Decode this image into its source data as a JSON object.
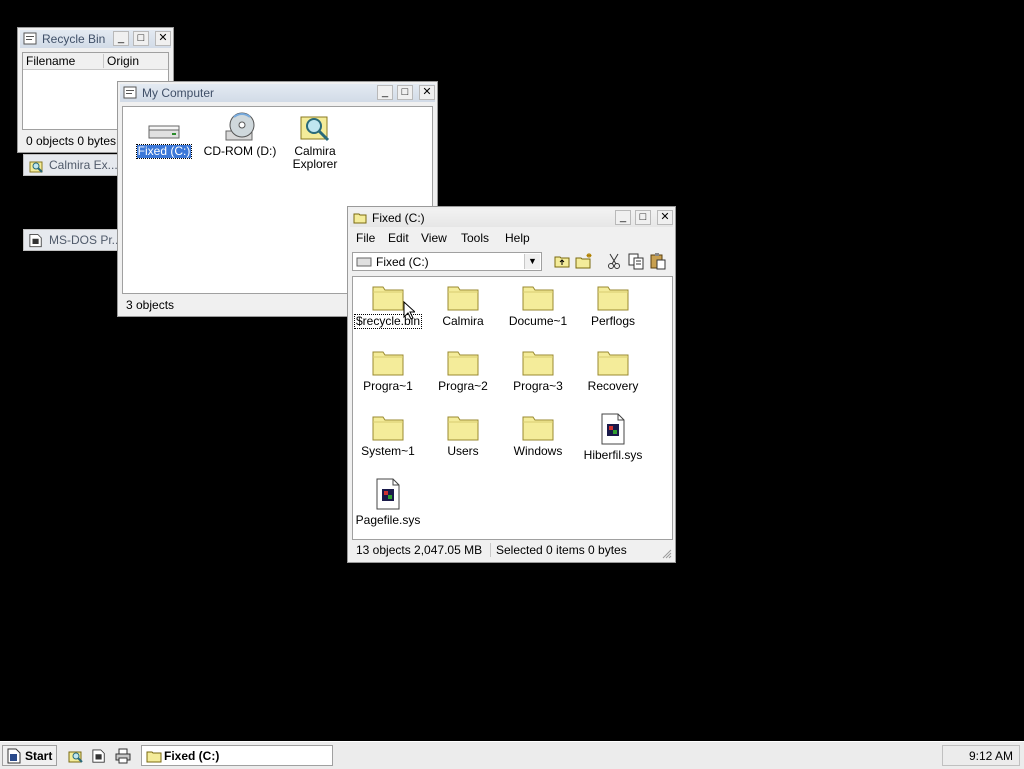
{
  "recycle_bin": {
    "title": "Recycle Bin",
    "columns": [
      "Filename",
      "Origin"
    ],
    "status": "0 objects  0 bytes"
  },
  "minimized": {
    "calmira_explorer": "Calmira Ex...",
    "msdos_prompt": "MS-DOS Pr..."
  },
  "my_computer": {
    "title": "My Computer",
    "items": [
      "Fixed (C:)",
      "CD-ROM (D:)",
      "Calmira Explorer"
    ],
    "item_lines": {
      "calmira_1": "Calmira",
      "calmira_2": "Explorer"
    },
    "status": "3 objects"
  },
  "fixed_c": {
    "title": "Fixed (C:)",
    "menu": [
      "File",
      "Edit",
      "View",
      "Tools",
      "Help"
    ],
    "drive_select": "Fixed (C:)",
    "items": [
      {
        "label": "$recycle.bin",
        "type": "folder"
      },
      {
        "label": "Calmira",
        "type": "folder"
      },
      {
        "label": "Docume~1",
        "type": "folder"
      },
      {
        "label": "Perflogs",
        "type": "folder"
      },
      {
        "label": "Progra~1",
        "type": "folder"
      },
      {
        "label": "Progra~2",
        "type": "folder"
      },
      {
        "label": "Progra~3",
        "type": "folder"
      },
      {
        "label": "Recovery",
        "type": "folder"
      },
      {
        "label": "System~1",
        "type": "folder"
      },
      {
        "label": "Users",
        "type": "folder"
      },
      {
        "label": "Windows",
        "type": "folder"
      },
      {
        "label": "Hiberfil.sys",
        "type": "file"
      },
      {
        "label": "Pagefile.sys",
        "type": "file"
      }
    ],
    "status_left": "13 objects  2,047.05 MB",
    "status_right": "Selected 0 items  0 bytes"
  },
  "taskbar": {
    "start": "Start",
    "task": "Fixed (C:)",
    "clock": "9:12 AM"
  },
  "colors": {
    "desktop": "#000000",
    "selection": "#3c78d8",
    "folder_yellow": "#f4ec9a"
  },
  "icons": [
    "app-icon",
    "minimize-icon",
    "maximize-icon",
    "close-icon",
    "hard-drive-icon",
    "cdrom-icon",
    "explorer-icon",
    "folder-icon",
    "file-icon",
    "up-folder-icon",
    "new-folder-icon",
    "cut-icon",
    "copy-icon",
    "paste-icon",
    "dropdown-arrow-icon"
  ]
}
